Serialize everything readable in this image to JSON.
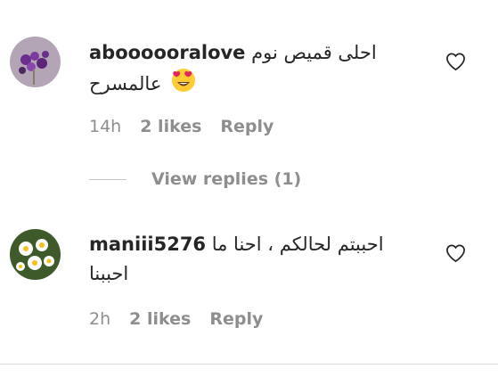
{
  "comments": [
    {
      "username": "aboooooralove",
      "text_line1": "احلى قميص نوم",
      "text_line2": "عالمسرح",
      "emoji": "heart-eyes-emoji",
      "time": "14h",
      "likes": "2 likes",
      "reply_label": "Reply",
      "avatar": "purple-flowers-avatar"
    },
    {
      "username": "maniii5276",
      "text_line1": "احببتم لحالكم ، احنا ما",
      "text_line2": "احببنا",
      "time": "2h",
      "likes": "2 likes",
      "reply_label": "Reply",
      "avatar": "daisies-avatar"
    }
  ],
  "view_replies": "View replies (1)",
  "icons": {
    "like": "heart-outline-icon"
  },
  "colors": {
    "text": "#262626",
    "secondary": "#8e8e8e",
    "divider": "#dbdbdb"
  }
}
